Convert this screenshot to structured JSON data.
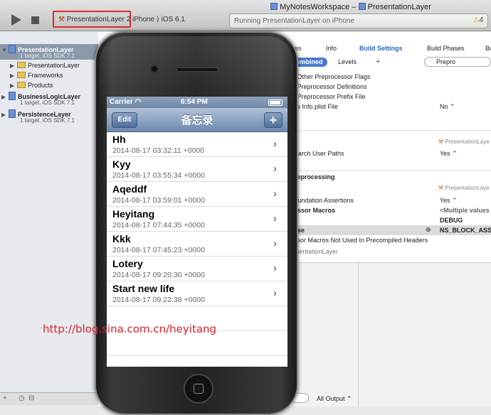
{
  "toolbar": {
    "scheme": "PresentationLayer",
    "scheme_suffix": "2",
    "device": "iPhone",
    "os": "iOS 6.1",
    "workspace": "MyNotesWorkspace",
    "project": "PresentationLayer",
    "status": "Running PresentationLayer on iPhone",
    "warnings": "4"
  },
  "navigator": {
    "projects": [
      {
        "name": "PresentationLayer",
        "sub": "1 target, iOS SDK 7.1",
        "children": [
          "PresentationLayer",
          "Frameworks",
          "Products"
        ]
      },
      {
        "name": "BusinessLogicLayer",
        "sub": "1 target, iOS SDK 7.1"
      },
      {
        "name": "PersistenceLayer",
        "sub": "1 target, iOS SDK 7.1"
      }
    ]
  },
  "editor": {
    "tabs": [
      "es",
      "Info",
      "Build Settings",
      "Build Phases",
      "Bu"
    ],
    "combined": "ombined",
    "levels": "Levels",
    "search": "Prepro",
    "rows": [
      {
        "label": "st Other Preprocessor Flags",
        "value": ""
      },
      {
        "label": "st Preprocessor Definitions",
        "value": ""
      },
      {
        "label": "st Preprocessor Prefix File",
        "value": ""
      },
      {
        "label": "ess Info.plist File",
        "value": "No ⌃"
      }
    ],
    "col_head_1": "PresentationLaye",
    "search_paths_label": "Search User Paths",
    "search_paths_value": "Yes ⌃",
    "section_preprocessing": "Preprocessing",
    "col_head_2": "PresentationLaye",
    "foundation_label": "Foundation Assertions",
    "foundation_value": "Yes ⌃",
    "macros_label": "cessor Macros",
    "macros_value": "<Multiple values",
    "debug_label": "ug",
    "debug_value": "DEBUG",
    "release_label": "ease",
    "release_value": "NS_BLOCK_ASSE",
    "unused_label": "essor Macros Not Used In Precompiled Headers",
    "footer_label": "resentationLayer",
    "all_output": "All Output ⌃"
  },
  "phone": {
    "carrier": "Carrier",
    "time": "6:54 PM",
    "edit": "Edit",
    "title": "备忘录",
    "add": "+",
    "notes": [
      {
        "title": "Hh",
        "date": "2014-08-17 03:32:11 +0000"
      },
      {
        "title": "Kyy",
        "date": "2014-08-17 03:55:34 +0000"
      },
      {
        "title": "Aqeddf",
        "date": "2014-08-17 03:59:01 +0000"
      },
      {
        "title": "Heyitang",
        "date": "2014-08-17 07:44:35 +0000"
      },
      {
        "title": "Kkk",
        "date": "2014-08-17 07:45:23 +0000"
      },
      {
        "title": "Lotery",
        "date": "2014-08-17 09:20:30 +0000"
      },
      {
        "title": "Start new life",
        "date": "2014-08-17 09:22:38 +0000"
      }
    ]
  },
  "watermark": "http://blog.sina.com.cn/heyitang"
}
